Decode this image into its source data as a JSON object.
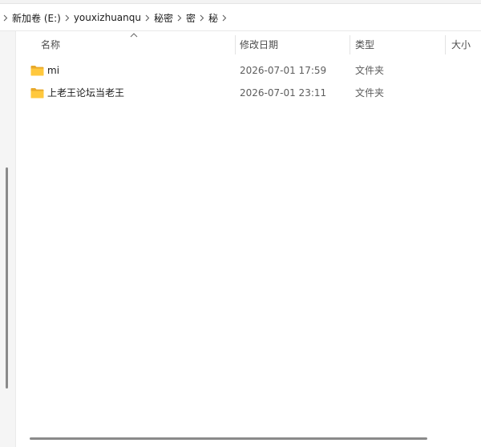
{
  "breadcrumb": {
    "items": [
      "新加卷 (E:)",
      "youxizhuanqu",
      "秘密",
      "密",
      "秘"
    ]
  },
  "columns": {
    "name": "名称",
    "date": "修改日期",
    "type": "类型",
    "size": "大小",
    "sort": "ascending"
  },
  "files": [
    {
      "name": "mi",
      "date": "2026-07-01 17:59",
      "type": "文件夹",
      "icon": "folder-icon"
    },
    {
      "name": "上老王论坛当老王",
      "date": "2026-07-01 23:11",
      "type": "文件夹",
      "icon": "folder-icon"
    }
  ],
  "colors": {
    "folder": "#ffc83d",
    "folder_tab": "#e8a92a",
    "text": "#1a1a1a",
    "secondary_text": "#5d5d5d"
  }
}
